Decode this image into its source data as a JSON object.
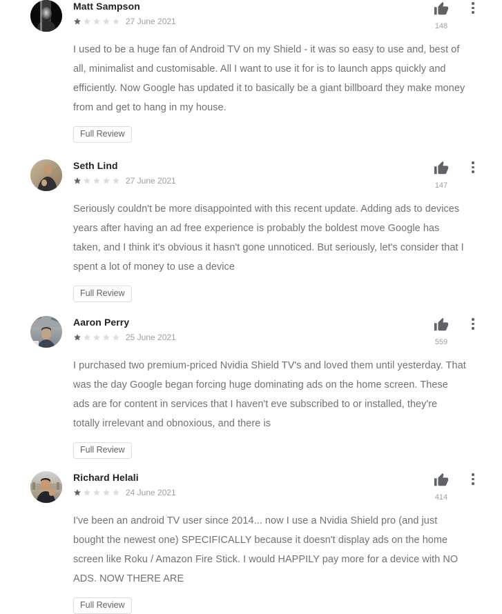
{
  "app": {
    "screen": "google-play-reviews-list"
  },
  "labels": {
    "full_review": "Full Review",
    "thumb_up_icon": "thumb-up-icon",
    "overflow_icon": "more-options-icon",
    "star_icon": "star-icon"
  },
  "reviews": [
    {
      "author": "Matt Sampson",
      "rating": 1,
      "max_rating": 5,
      "date": "27 June 2021",
      "helpful_count": "148",
      "body": "I used to be a huge fan of Android TV on my Shield - it was so easy to use and, best of all, minimalist and customisable. All I want to use it for is to launch apps quickly and efficiently. Now Google has updated it to basically be a giant billboard they make money from and get to hang in my house.",
      "full_review_label": "Full Review",
      "avatar": "portrait-black-and-white-man"
    },
    {
      "author": "Seth Lind",
      "rating": 1,
      "max_rating": 5,
      "date": "27 June 2021",
      "helpful_count": "147",
      "body": "Seriously couldn't be more disappointed with this recent update. Adding ads to devices years after having an ad free experience is probably the boldest move Google has taken, and I think it's obvious it hasn't gone unnoticed. But seriously, let's consider that I spent a lot of money to use a device",
      "full_review_label": "Full Review",
      "avatar": "portrait-man-dark-shirt"
    },
    {
      "author": "Aaron Perry",
      "rating": 1,
      "max_rating": 5,
      "date": "25 June 2021",
      "helpful_count": "559",
      "body": "I purchased two premium-priced Nvidia Shield TV's and loved them until yesterday. That was the day Google began forcing huge dominating ads on the home screen. These ads are for content in services that I haven't eve subscribed to or installed, they're totally irrelevant and obnoxious, and there is",
      "full_review_label": "Full Review",
      "avatar": "portrait-man-indoors"
    },
    {
      "author": "Richard Helali",
      "rating": 1,
      "max_rating": 5,
      "date": "24 June 2021",
      "helpful_count": "414",
      "body": "I've been an android TV user since 2014... now I use a Nvidia Shield pro (and just bought the newest one) SPECIFICALLY because it doesn't display ads on the home screen like Roku / Amazon Fire Stick. I would HAPPILY pay more for a device with NO ADS. NOW THERE ARE",
      "full_review_label": "Full Review",
      "avatar": "portrait-man-outdoors"
    }
  ],
  "colors": {
    "text_primary": "#202124",
    "text_body": "#6e7275",
    "text_muted": "#9aa0a6",
    "star_on": "#5f6368",
    "star_off": "#dadce0",
    "chip_border": "#dadce0",
    "background": "#ffffff"
  }
}
